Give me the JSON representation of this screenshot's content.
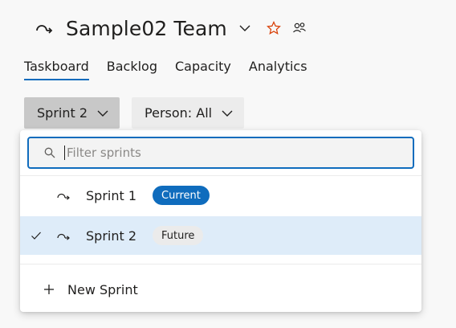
{
  "header": {
    "team_name": "Sample02 Team",
    "icons": {
      "team": "team-iteration-icon",
      "chevron": "chevron-down-icon",
      "favorite": "star-icon",
      "members": "people-icon"
    }
  },
  "tabs": [
    {
      "label": "Taskboard",
      "active": true
    },
    {
      "label": "Backlog",
      "active": false
    },
    {
      "label": "Capacity",
      "active": false
    },
    {
      "label": "Analytics",
      "active": false
    }
  ],
  "filters": {
    "sprint_label": "Sprint 2",
    "person_label": "Person: All"
  },
  "dropdown": {
    "search_placeholder": "Filter sprints",
    "search_value": "",
    "items": [
      {
        "name": "Sprint 1",
        "badge": "Current",
        "selected": false
      },
      {
        "name": "Sprint 2",
        "badge": "Future",
        "selected": true
      }
    ],
    "new_sprint_label": "New Sprint"
  },
  "colors": {
    "accent": "#0f6cbd",
    "selected_row": "#deecf9",
    "star": "#d83b01"
  }
}
